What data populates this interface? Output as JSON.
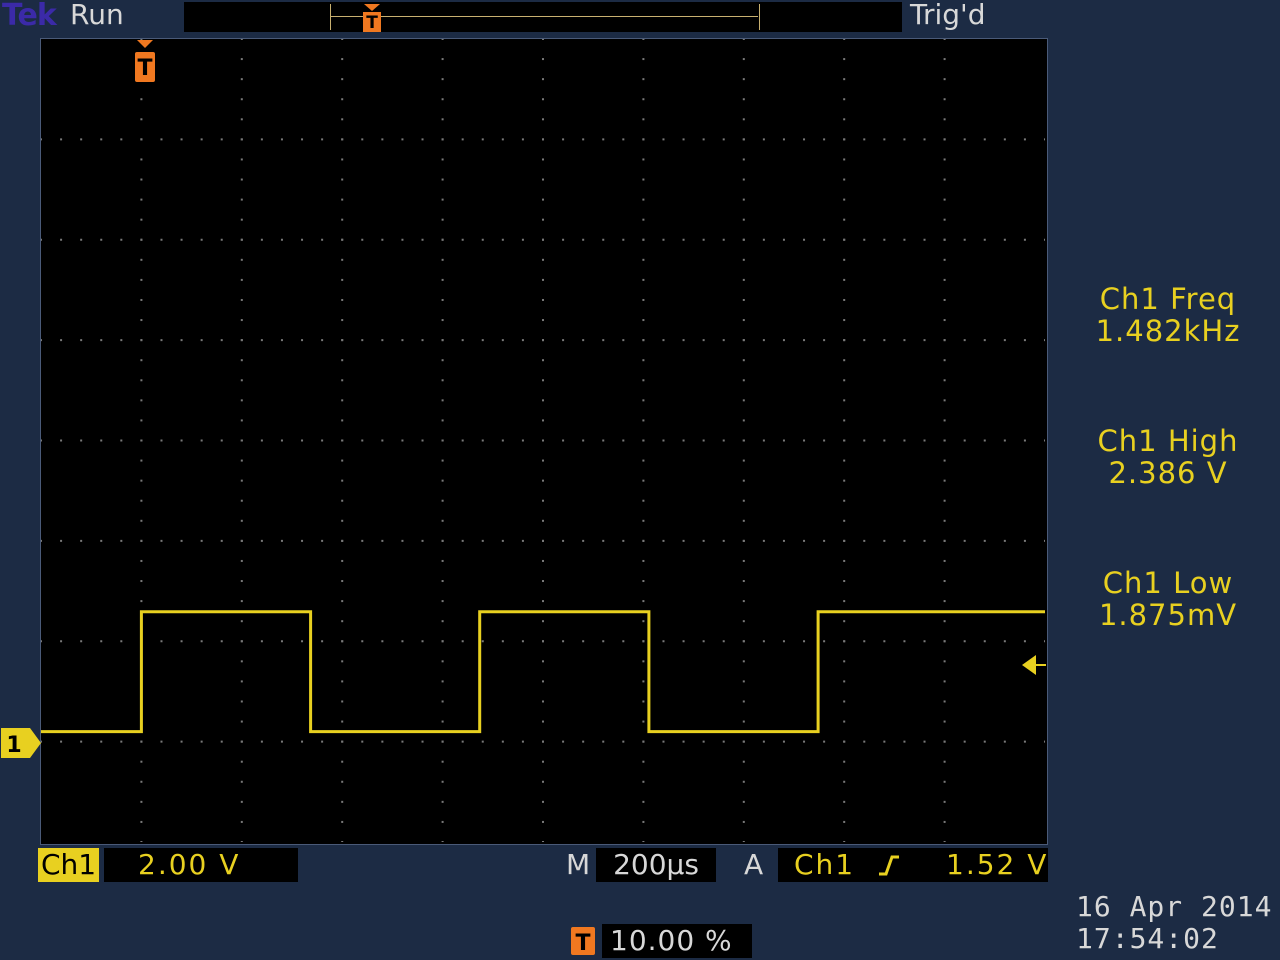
{
  "header": {
    "brand": "Tek",
    "run_state": "Run",
    "trigger_status": "Trig'd"
  },
  "trigger_marker_label": "T",
  "channel_marker_label": "1",
  "measurements": [
    {
      "label": "Ch1 Freq",
      "value": "1.482kHz"
    },
    {
      "label": "Ch1 High",
      "value": "2.386 V"
    },
    {
      "label": "Ch1 Low",
      "value": "1.875mV"
    }
  ],
  "status_bar": {
    "channel": "Ch1",
    "volts_per_div": "2.00 V",
    "timebase_prefix": "M",
    "time_per_div": "200µs",
    "trigger_prefix": "A",
    "trigger_source": "Ch1",
    "trigger_slope_icon": "rising-edge-icon",
    "trigger_level": "1.52 V",
    "trigger_position_label": "T",
    "trigger_position": "10.00 %"
  },
  "datetime": {
    "date": "16 Apr  2014",
    "time": "17:54:02"
  },
  "colors": {
    "trace": "#e8d020",
    "trigger": "#f07820",
    "background": "#1c2b44",
    "screen": "#000000"
  },
  "chart_data": {
    "type": "line",
    "series": [
      {
        "name": "Ch1",
        "x": [
          -0.2,
          0.0,
          0.0,
          0.337,
          0.337,
          0.674,
          0.674,
          1.011,
          1.011,
          1.348,
          1.348,
          1.8
        ],
        "y": [
          0.0,
          0.0,
          2.386,
          2.386,
          0.0,
          0.0,
          2.386,
          2.386,
          0.0,
          0.0,
          2.386,
          2.386
        ]
      }
    ],
    "xlabel": "",
    "ylabel": "",
    "xlim": [
      -0.2,
      1.8
    ],
    "ylim": [
      -2.2,
      13.8
    ],
    "grid": true
  }
}
